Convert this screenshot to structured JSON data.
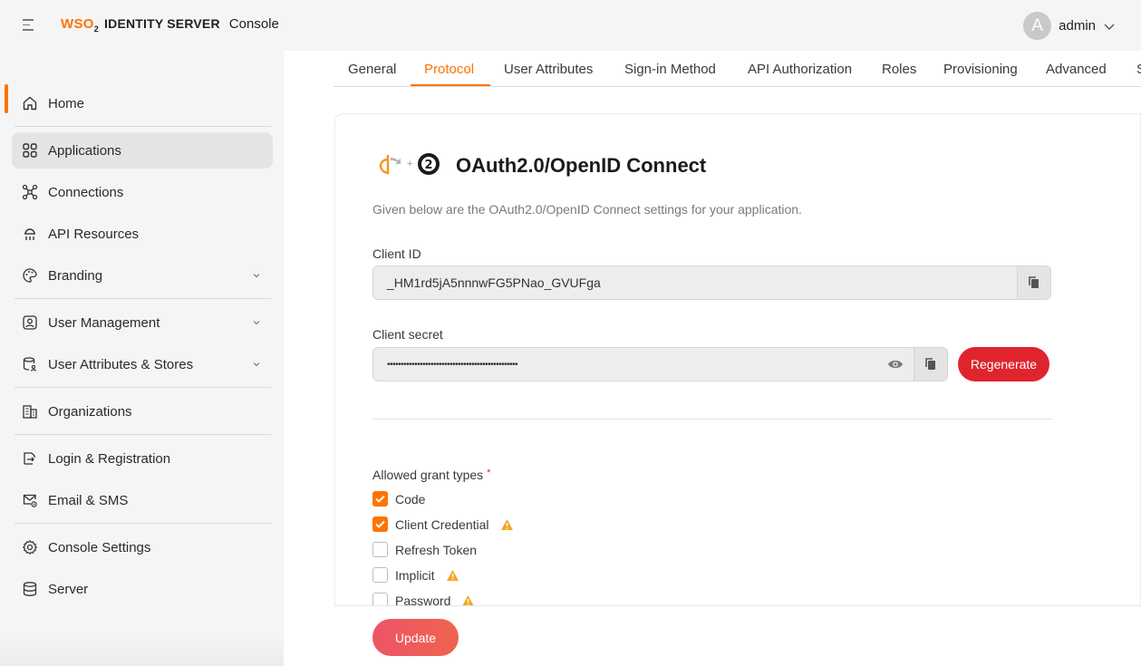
{
  "header": {
    "logo_brand": "WSO",
    "logo_brand_sub": "2",
    "logo_product": "IDENTITY SERVER",
    "logo_console": "Console",
    "avatar_letter": "A",
    "username": "admin"
  },
  "sidebar": {
    "items": [
      {
        "label": "Home",
        "icon": "home-icon"
      },
      {
        "label": "Applications",
        "icon": "applications-icon",
        "active": true
      },
      {
        "label": "Connections",
        "icon": "connections-icon"
      },
      {
        "label": "API Resources",
        "icon": "api-resources-icon"
      },
      {
        "label": "Branding",
        "icon": "branding-icon",
        "expandable": true
      },
      {
        "label": "User Management",
        "icon": "user-management-icon",
        "expandable": true
      },
      {
        "label": "User Attributes & Stores",
        "icon": "user-attributes-icon",
        "expandable": true
      },
      {
        "label": "Organizations",
        "icon": "organizations-icon"
      },
      {
        "label": "Login & Registration",
        "icon": "login-registration-icon"
      },
      {
        "label": "Email & SMS",
        "icon": "email-sms-icon"
      },
      {
        "label": "Console Settings",
        "icon": "gear-icon"
      },
      {
        "label": "Server",
        "icon": "server-icon"
      }
    ]
  },
  "tabs": [
    {
      "label": "General"
    },
    {
      "label": "Protocol",
      "active": true
    },
    {
      "label": "User Attributes"
    },
    {
      "label": "Sign-in Method"
    },
    {
      "label": "API Authorization"
    },
    {
      "label": "Roles"
    },
    {
      "label": "Provisioning"
    },
    {
      "label": "Advanced"
    },
    {
      "label": "S"
    }
  ],
  "protocol": {
    "title": "OAuth2.0/OpenID Connect",
    "subtitle": "Given below are the OAuth2.0/OpenID Connect settings for your application.",
    "client_id_label": "Client ID",
    "client_id_value": "_HM1rd5jA5nnnwFG5PNao_GVUFga",
    "client_secret_label": "Client secret",
    "client_secret_value": "••••••••••••••••••••••••••••••••••••••••••••••••",
    "regenerate_label": "Regenerate",
    "grant_types_label": "Allowed grant types",
    "required_mark": "*",
    "grant_types": [
      {
        "label": "Code",
        "checked": true,
        "warning": false
      },
      {
        "label": "Client Credential",
        "checked": true,
        "warning": true
      },
      {
        "label": "Refresh Token",
        "checked": false,
        "warning": false
      },
      {
        "label": "Implicit",
        "checked": false,
        "warning": true
      },
      {
        "label": "Password",
        "checked": false,
        "warning": true
      }
    ],
    "update_label": "Update"
  },
  "colors": {
    "accent": "#ff7300",
    "danger": "#e0242e",
    "warning": "#f5a623"
  }
}
